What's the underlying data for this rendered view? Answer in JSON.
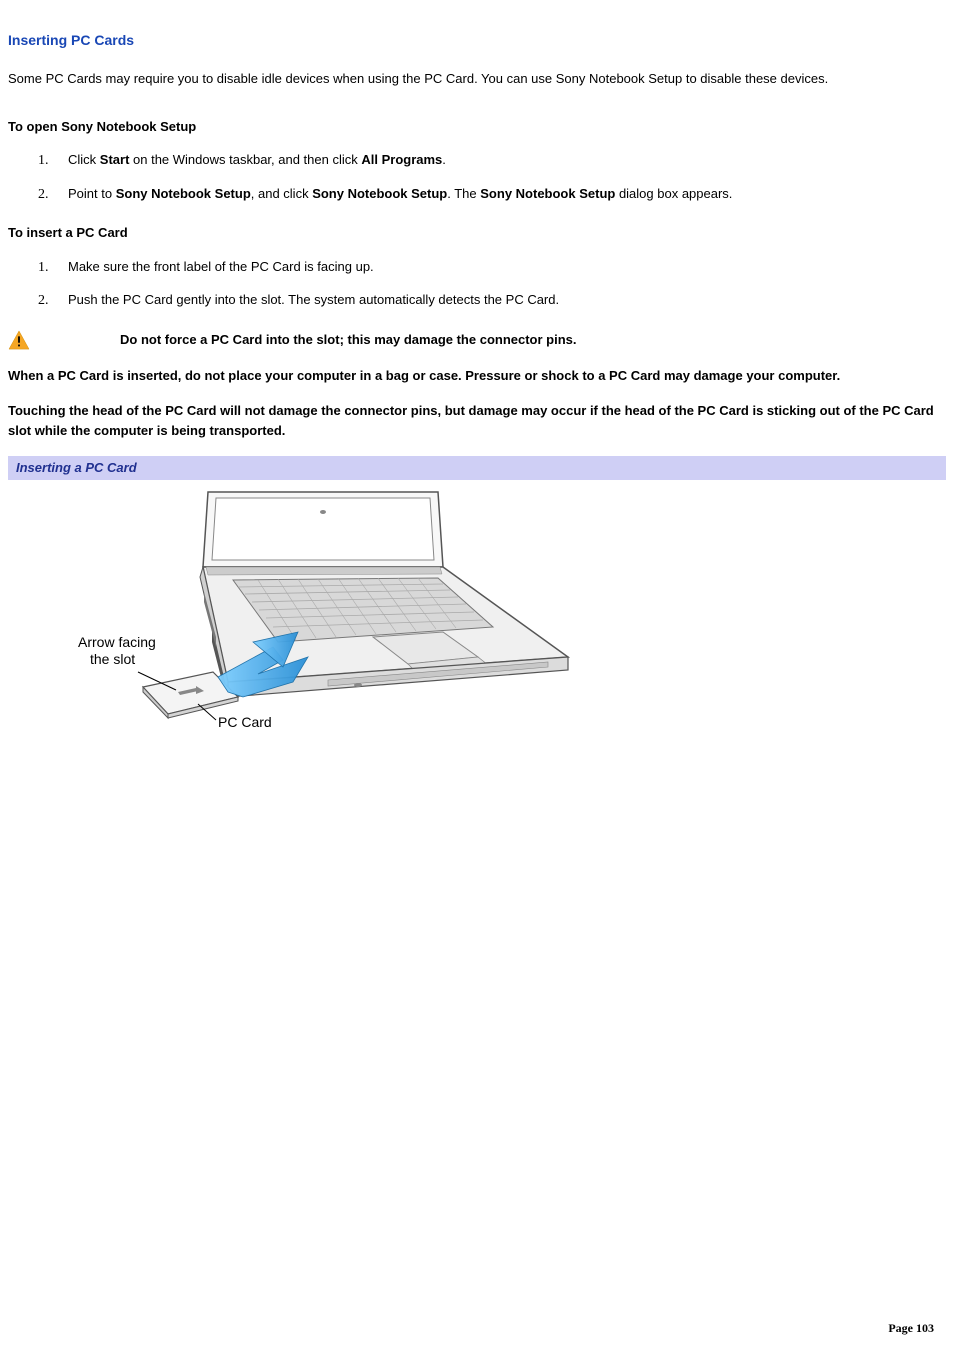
{
  "heading": "Inserting PC Cards",
  "intro": "Some PC Cards may require you to disable idle devices when using the PC Card. You can use Sony Notebook Setup to disable these devices.",
  "section1": {
    "title": "To open Sony Notebook Setup",
    "step1_a": "Click ",
    "step1_b": "Start",
    "step1_c": " on the Windows taskbar, and then click ",
    "step1_d": "All Programs",
    "step1_e": ".",
    "step2_a": "Point to ",
    "step2_b": "Sony Notebook Setup",
    "step2_c": ", and click ",
    "step2_d": "Sony Notebook Setup",
    "step2_e": ". The ",
    "step2_f": "Sony Notebook Setup",
    "step2_g": " dialog box appears."
  },
  "section2": {
    "title": "To insert a PC Card",
    "step1": "Make sure the front label of the PC Card is facing up.",
    "step2": "Push the PC Card gently into the slot. The system automatically detects the PC Card."
  },
  "warning": "Do not force a PC Card into the slot; this may damage the connector pins.",
  "bold1": "When a PC Card is inserted, do not place your computer in a bag or case. Pressure or shock to a PC Card may damage your computer.",
  "bold2": "Touching the head of the PC Card will not damage the connector pins, but damage may occur if the head of the PC Card is sticking out of the PC Card slot while the computer is being transported.",
  "figure_caption": "Inserting a PC Card",
  "figure_labels": {
    "arrow_line1": "Arrow facing",
    "arrow_line2": "the slot",
    "pc_card": "PC Card"
  },
  "page_number": "Page 103"
}
